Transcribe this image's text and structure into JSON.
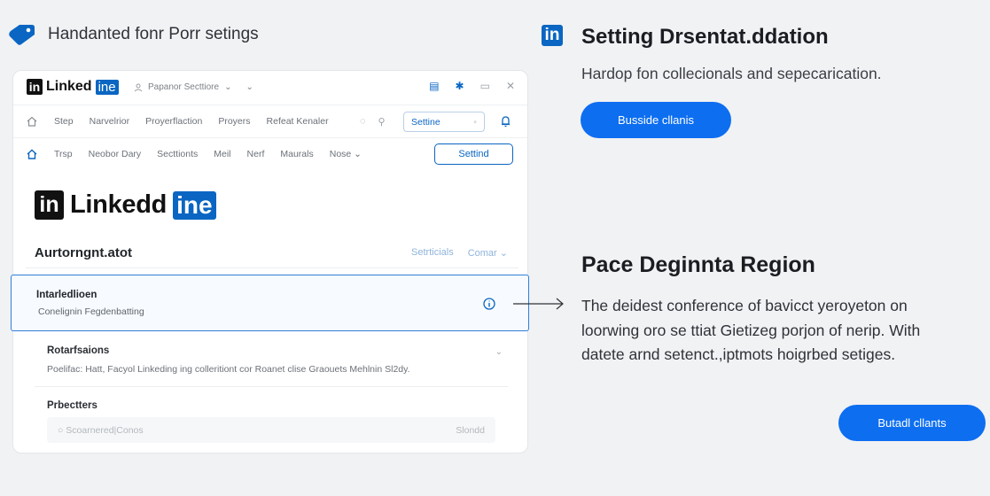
{
  "header": {
    "caption": "Handanted fonr Porr setings",
    "icon": "tag-icon"
  },
  "window": {
    "brand_word": "Linked",
    "brand_suffix": "ine",
    "in_glyph": "in",
    "profile_select": "Papanor Secttiore",
    "nav1": {
      "items": [
        "Step",
        "Narvelrior",
        "Proyerflaction",
        "Proyers",
        "Refeat Kenaler"
      ],
      "setting_field": "Settine"
    },
    "nav2": {
      "items": [
        "Trsp",
        "Neobor Dary",
        "Secttionts",
        "Meil",
        "Nerf",
        "Maurals",
        "Nose"
      ],
      "setting_button": "Settind"
    },
    "big_brand_word": "Linkedd",
    "big_brand_suffix": "ine",
    "section": {
      "heading": "Aurtorngnt.atot",
      "right_link": "Setrticials",
      "right_select": "Comar"
    },
    "highlight": {
      "title": "Intarledlioen",
      "subtitle": "Conelignin Fegdenbatting"
    },
    "list": [
      {
        "title": "Rotarfsaions",
        "subtitle": "Poelifac: Hatt, Facyol Linkeding ing colleritiont cor Roanet clise Graouets Mehlnin Sl2dy."
      },
      {
        "title": "Prbectters",
        "subtitle": ""
      }
    ],
    "search": {
      "placeholder": "Scoarnered|Conos",
      "action": "Slondd"
    }
  },
  "right": {
    "title": "Setting Drsentat.ddation",
    "subtitle": "Hardop fon collecionals and sepecarication.",
    "button1": "Busside cllanis",
    "region_title": "Pace Deginnta Region",
    "region_body": "The deidest conference of bavicct yeroyeton on loorwing oro se ttiat Gietizeg porjon of nerip. With datete arnd setenct.,iptmots hoigrbed setiges.",
    "button2": "Butadl cllants"
  },
  "colors": {
    "accent": "#0a66c2",
    "pill": "#0d6ef0",
    "background": "#f1f2f4"
  }
}
